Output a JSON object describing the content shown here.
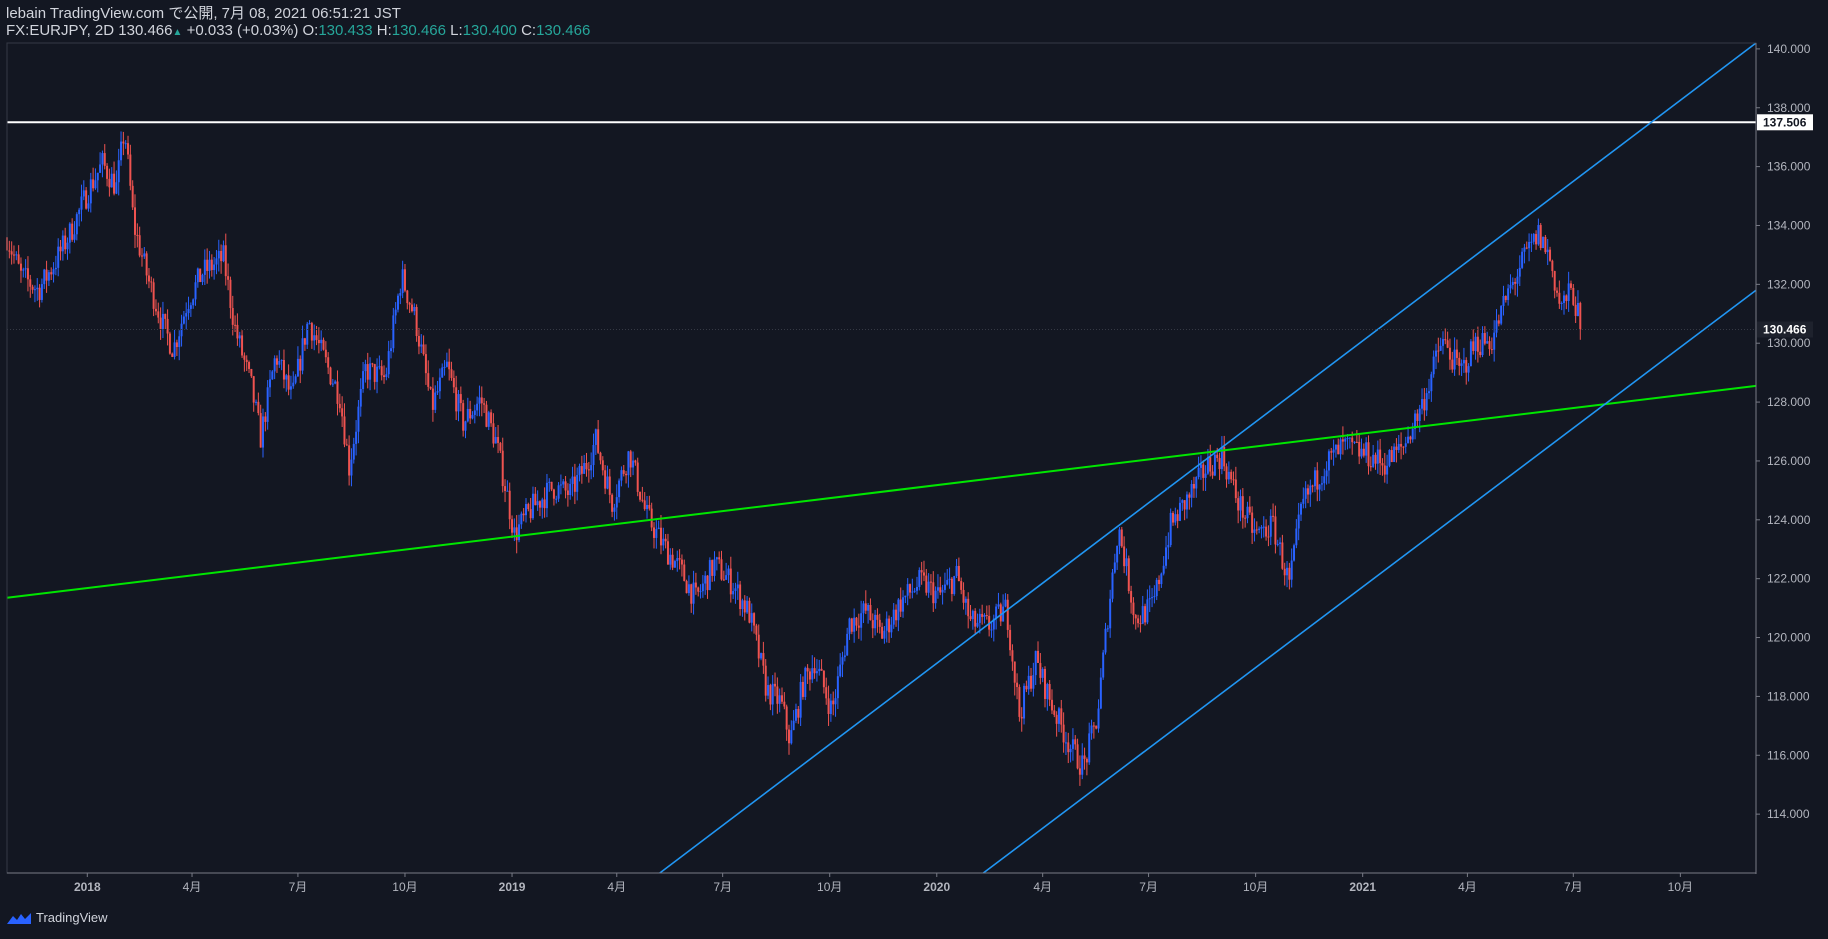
{
  "header": {
    "published": "lebain TradingView.com で公開, 7月 08, 2021 06:51:21 JST",
    "symbol": "FX:EURJPY, 2D",
    "last": "130.466",
    "arrow": "▲",
    "change": "+0.033 (+0.03%)",
    "o_label": "O:",
    "o_value": "130.433",
    "h_label": "H:",
    "h_value": "130.466",
    "l_label": "L:",
    "l_value": "130.400",
    "c_label": "C:",
    "c_value": "130.466"
  },
  "footer": {
    "brand": "TradingView"
  },
  "colors": {
    "background": "#131722",
    "up": "#2962ff",
    "down": "#ef5350",
    "channel": "#2196f3",
    "trendline": "#00e600",
    "resistance": "#ffffff"
  },
  "chart_data": {
    "type": "candlestick",
    "symbol": "FX:EURJPY",
    "interval": "2D",
    "ylim": [
      112.0,
      140.2
    ],
    "y_ticks": [
      "114.000",
      "116.000",
      "118.000",
      "120.000",
      "122.000",
      "124.000",
      "126.000",
      "128.000",
      "130.000",
      "132.000",
      "134.000",
      "136.000",
      "138.000",
      "140.000"
    ],
    "x_ticks": [
      {
        "label": "2018",
        "date": "2018-01-01",
        "bold": true
      },
      {
        "label": "4月",
        "date": "2018-04-01"
      },
      {
        "label": "7月",
        "date": "2018-07-01"
      },
      {
        "label": "10月",
        "date": "2018-10-01"
      },
      {
        "label": "2019",
        "date": "2019-01-01",
        "bold": true
      },
      {
        "label": "4月",
        "date": "2019-04-01"
      },
      {
        "label": "7月",
        "date": "2019-07-01"
      },
      {
        "label": "10月",
        "date": "2019-10-01"
      },
      {
        "label": "2020",
        "date": "2020-01-01",
        "bold": true
      },
      {
        "label": "4月",
        "date": "2020-04-01"
      },
      {
        "label": "7月",
        "date": "2020-07-01"
      },
      {
        "label": "10月",
        "date": "2020-10-01"
      },
      {
        "label": "2021",
        "date": "2021-01-01",
        "bold": true
      },
      {
        "label": "4月",
        "date": "2021-04-01"
      },
      {
        "label": "7月",
        "date": "2021-07-01"
      },
      {
        "label": "10月",
        "date": "2021-10-01"
      }
    ],
    "x_range": [
      "2017-10-24",
      "2021-12-05"
    ],
    "last_price": "130.466",
    "horizontal_line": {
      "value": 137.506,
      "label": "137.506"
    },
    "trendline": {
      "start": {
        "date": "2017-10-24",
        "value": 121.35
      },
      "end": {
        "date": "2021-12-05",
        "value": 128.55
      }
    },
    "channel_upper": {
      "start": {
        "date": "2019-05-08",
        "value": 112.0
      },
      "end": {
        "date": "2021-12-05",
        "value": 140.2
      }
    },
    "channel_lower": {
      "start": {
        "date": "2020-02-10",
        "value": 112.0
      },
      "end": {
        "date": "2021-12-05",
        "value": 131.8
      }
    },
    "price_path": [
      [
        "2017-10-24",
        133.6
      ],
      [
        "2017-11-05",
        132.3
      ],
      [
        "2017-11-20",
        131.8
      ],
      [
        "2017-12-05",
        132.8
      ],
      [
        "2017-12-18",
        133.8
      ],
      [
        "2018-01-02",
        135.2
      ],
      [
        "2018-01-14",
        136.1
      ],
      [
        "2018-01-26",
        135.3
      ],
      [
        "2018-02-02",
        137.3
      ],
      [
        "2018-02-10",
        134.0
      ],
      [
        "2018-02-22",
        132.2
      ],
      [
        "2018-03-08",
        130.5
      ],
      [
        "2018-03-16",
        129.8
      ],
      [
        "2018-03-28",
        131.4
      ],
      [
        "2018-04-10",
        132.4
      ],
      [
        "2018-04-28",
        132.9
      ],
      [
        "2018-05-08",
        130.5
      ],
      [
        "2018-05-22",
        128.5
      ],
      [
        "2018-05-30",
        126.8
      ],
      [
        "2018-06-12",
        129.6
      ],
      [
        "2018-06-26",
        128.1
      ],
      [
        "2018-07-10",
        130.8
      ],
      [
        "2018-07-22",
        129.6
      ],
      [
        "2018-08-06",
        128.2
      ],
      [
        "2018-08-14",
        125.8
      ],
      [
        "2018-08-28",
        129.1
      ],
      [
        "2018-09-14",
        128.8
      ],
      [
        "2018-09-28",
        132.3
      ],
      [
        "2018-10-10",
        130.8
      ],
      [
        "2018-10-24",
        127.8
      ],
      [
        "2018-11-06",
        129.2
      ],
      [
        "2018-11-20",
        127.3
      ],
      [
        "2018-12-05",
        128.1
      ],
      [
        "2018-12-18",
        126.7
      ],
      [
        "2018-12-28",
        124.8
      ],
      [
        "2019-01-03",
        123.5
      ],
      [
        "2019-01-18",
        124.4
      ],
      [
        "2019-02-05",
        125.1
      ],
      [
        "2019-02-20",
        124.9
      ],
      [
        "2019-03-06",
        125.9
      ],
      [
        "2019-03-14",
        126.7
      ],
      [
        "2019-03-28",
        124.6
      ],
      [
        "2019-04-12",
        126.3
      ],
      [
        "2019-04-26",
        124.2
      ],
      [
        "2019-05-10",
        123.2
      ],
      [
        "2019-05-24",
        122.4
      ],
      [
        "2019-06-08",
        121.3
      ],
      [
        "2019-06-24",
        122.5
      ],
      [
        "2019-07-10",
        121.8
      ],
      [
        "2019-07-24",
        120.8
      ],
      [
        "2019-08-08",
        118.2
      ],
      [
        "2019-08-20",
        117.8
      ],
      [
        "2019-08-28",
        116.5
      ],
      [
        "2019-09-08",
        118.4
      ],
      [
        "2019-09-18",
        119.2
      ],
      [
        "2019-10-03",
        117.5
      ],
      [
        "2019-10-18",
        120.5
      ],
      [
        "2019-11-01",
        120.9
      ],
      [
        "2019-11-15",
        120.1
      ],
      [
        "2019-12-01",
        121.2
      ],
      [
        "2019-12-18",
        121.9
      ],
      [
        "2020-01-03",
        121.4
      ],
      [
        "2020-01-18",
        122.1
      ],
      [
        "2020-01-30",
        120.5
      ],
      [
        "2020-02-15",
        120.4
      ],
      [
        "2020-03-01",
        121.0
      ],
      [
        "2020-03-12",
        117.4
      ],
      [
        "2020-03-26",
        119.2
      ],
      [
        "2020-04-10",
        117.6
      ],
      [
        "2020-04-26",
        116.2
      ],
      [
        "2020-05-06",
        115.6
      ],
      [
        "2020-05-18",
        117.3
      ],
      [
        "2020-05-26",
        120.4
      ],
      [
        "2020-06-05",
        123.8
      ],
      [
        "2020-06-20",
        120.6
      ],
      [
        "2020-07-05",
        121.1
      ],
      [
        "2020-07-20",
        123.8
      ],
      [
        "2020-08-05",
        124.8
      ],
      [
        "2020-08-20",
        125.8
      ],
      [
        "2020-09-02",
        126.2
      ],
      [
        "2020-09-16",
        124.6
      ],
      [
        "2020-10-01",
        123.5
      ],
      [
        "2020-10-16",
        123.8
      ],
      [
        "2020-10-30",
        121.8
      ],
      [
        "2020-11-10",
        124.5
      ],
      [
        "2020-11-30",
        125.9
      ],
      [
        "2020-12-16",
        126.5
      ],
      [
        "2021-01-05",
        126.2
      ],
      [
        "2021-01-20",
        125.9
      ],
      [
        "2021-02-05",
        126.5
      ],
      [
        "2021-02-22",
        128.0
      ],
      [
        "2021-03-10",
        130.1
      ],
      [
        "2021-03-26",
        129.0
      ],
      [
        "2021-04-08",
        130.0
      ],
      [
        "2021-04-22",
        130.1
      ],
      [
        "2021-05-05",
        131.6
      ],
      [
        "2021-05-20",
        132.9
      ],
      [
        "2021-06-01",
        133.7
      ],
      [
        "2021-06-10",
        133.0
      ],
      [
        "2021-06-20",
        131.2
      ],
      [
        "2021-06-30",
        131.8
      ],
      [
        "2021-07-08",
        130.466
      ]
    ]
  }
}
